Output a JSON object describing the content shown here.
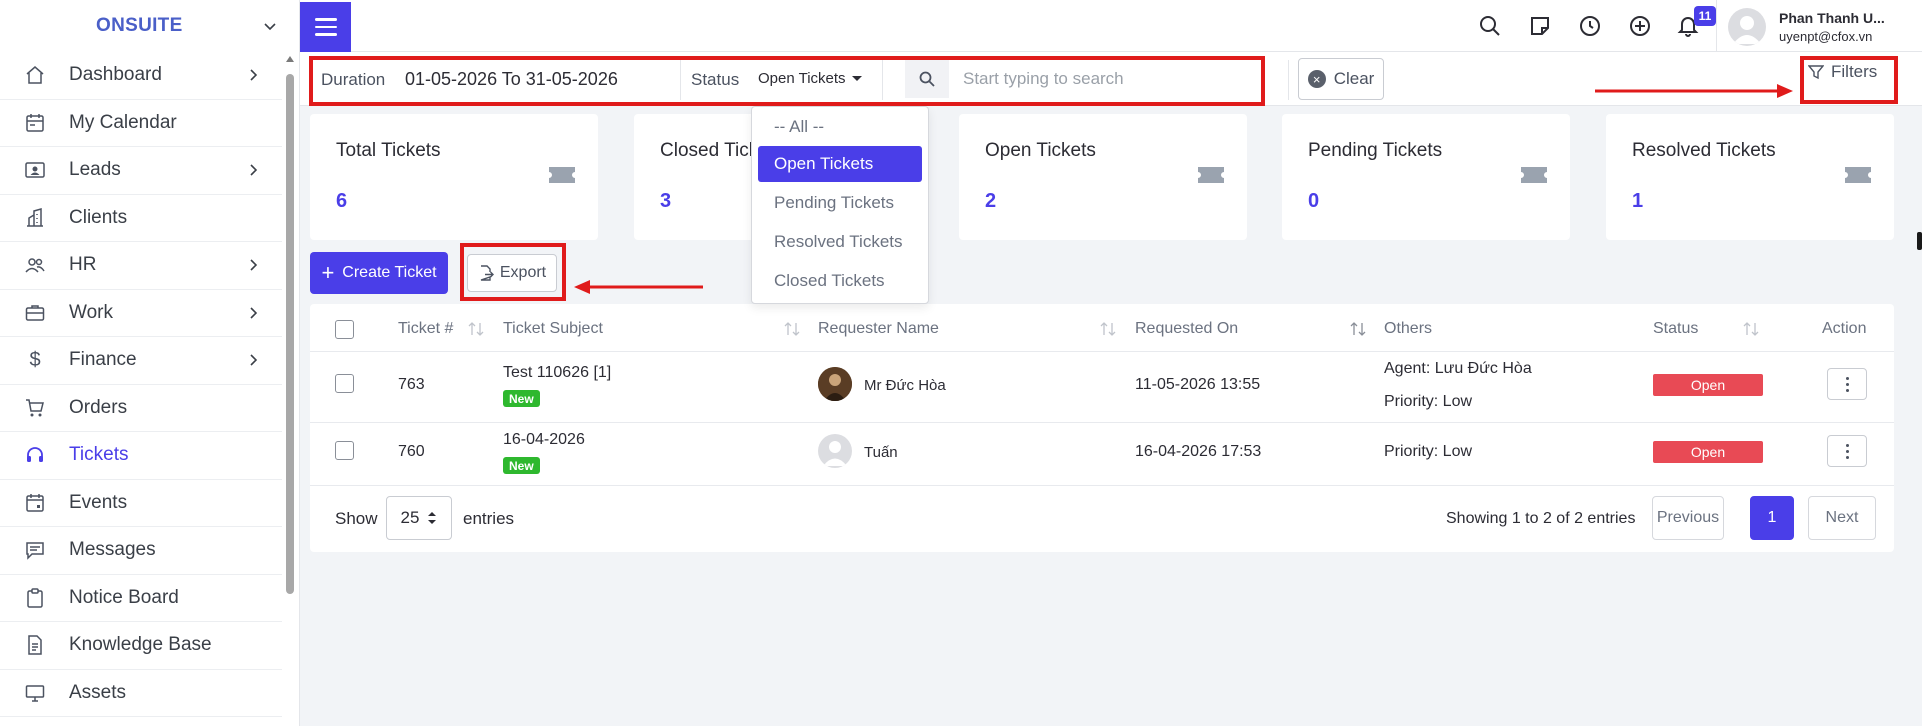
{
  "brand": "ONSUITE",
  "sidebar": {
    "items": [
      {
        "label": "Dashboard",
        "icon": "home-icon",
        "has_arrow": true
      },
      {
        "label": "My Calendar",
        "icon": "calendar-icon",
        "has_arrow": false
      },
      {
        "label": "Leads",
        "icon": "contact-card-icon",
        "has_arrow": true
      },
      {
        "label": "Clients",
        "icon": "building-icon",
        "has_arrow": false
      },
      {
        "label": "HR",
        "icon": "users-icon",
        "has_arrow": true
      },
      {
        "label": "Work",
        "icon": "briefcase-icon",
        "has_arrow": true
      },
      {
        "label": "Finance",
        "icon": "dollar-icon",
        "has_arrow": true
      },
      {
        "label": "Orders",
        "icon": "cart-icon",
        "has_arrow": false
      },
      {
        "label": "Tickets",
        "icon": "headset-icon",
        "has_arrow": false
      },
      {
        "label": "Events",
        "icon": "event-calendar-icon",
        "has_arrow": false
      },
      {
        "label": "Messages",
        "icon": "chat-icon",
        "has_arrow": false
      },
      {
        "label": "Notice Board",
        "icon": "clipboard-icon",
        "has_arrow": false
      },
      {
        "label": "Knowledge Base",
        "icon": "document-icon",
        "has_arrow": false
      },
      {
        "label": "Assets",
        "icon": "monitor-icon",
        "has_arrow": false
      }
    ],
    "active": "Tickets"
  },
  "topbar": {
    "notification_count": "11",
    "user_name": "Phan Thanh U...",
    "user_email": "uyenpt@cfox.vn"
  },
  "filters": {
    "duration_label": "Duration",
    "duration_value": "01-05-2026 To 31-05-2026",
    "status_label": "Status",
    "status_value": "Open Tickets",
    "search_placeholder": "Start typing to search",
    "clear_label": "Clear",
    "filters_label": "Filters"
  },
  "status_options": [
    "-- All --",
    "Open Tickets",
    "Pending Tickets",
    "Resolved Tickets",
    "Closed Tickets"
  ],
  "status_selected_index": 1,
  "cards": [
    {
      "title": "Total Tickets",
      "count": "6"
    },
    {
      "title": "Closed Tickets",
      "count": "3"
    },
    {
      "title": "Open Tickets",
      "count": "2"
    },
    {
      "title": "Pending Tickets",
      "count": "0"
    },
    {
      "title": "Resolved Tickets",
      "count": "1"
    }
  ],
  "actions": {
    "create_label": "Create Ticket",
    "export_label": "Export"
  },
  "table": {
    "columns": [
      "Ticket #",
      "Ticket Subject",
      "Requester Name",
      "Requested On",
      "Others",
      "Status",
      "Action"
    ],
    "rows": [
      {
        "ticket": "763",
        "subject": "Test 110626 [1]",
        "badge": "New",
        "requester": "Mr Đức Hòa",
        "requested_on": "11-05-2026 13:55",
        "others": [
          "Agent: Lưu Đức Hòa",
          "Priority: Low"
        ],
        "status": "Open"
      },
      {
        "ticket": "760",
        "subject": "16-04-2026",
        "badge": "New",
        "requester": "Tuấn",
        "requested_on": "16-04-2026 17:53",
        "others": [
          "Priority: Low"
        ],
        "status": "Open"
      }
    ]
  },
  "pagination": {
    "show_label": "Show",
    "page_size": "25",
    "entries_label": "entries",
    "summary": "Showing 1 to 2 of 2 entries",
    "previous": "Previous",
    "current_page": "1",
    "next": "Next"
  },
  "colors": {
    "accent": "#4a3ee8",
    "status_open": "#e84a55",
    "new_badge": "#2eb82e",
    "annotation": "#e01b1b"
  }
}
